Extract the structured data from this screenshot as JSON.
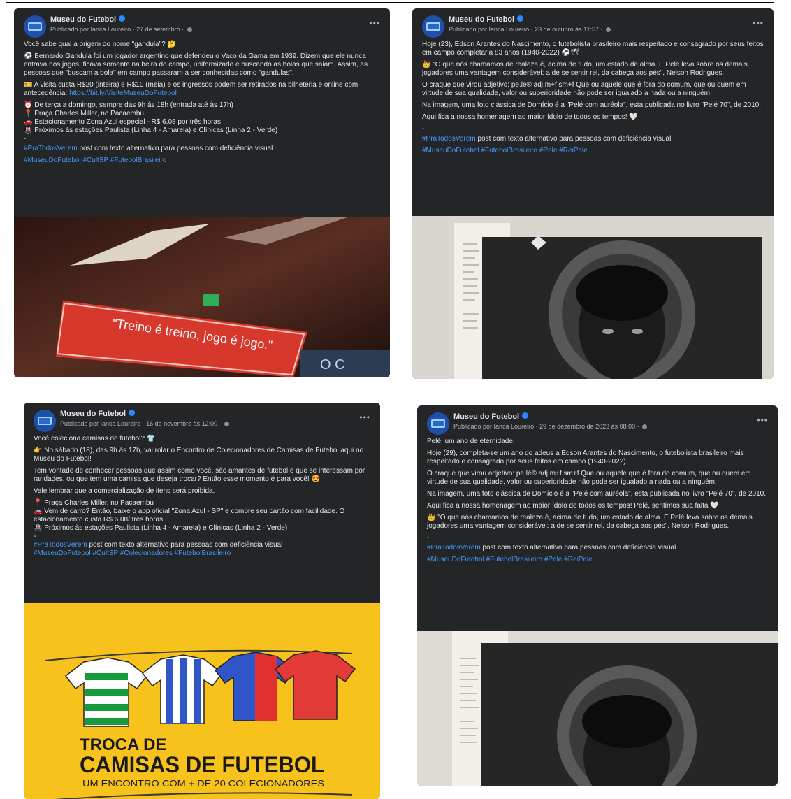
{
  "colors": {
    "post_bg": "#242526",
    "text": "#e4e6eb",
    "meta": "#b0b3b8",
    "hashtag": "#4599ff",
    "verified": "#2d88ff"
  },
  "posts": [
    {
      "page_name": "Museu do Futebol",
      "meta": "Publicado por Ianca Loureiro · 27 de setembro ·",
      "paragraphs": [
        "Você sabe qual a origem do nome \"gandula\"? 🤔",
        "⚽ Bernardo Gandula foi um jogador argentino que defendeu o Vaco da Gama em 1939. Dizem que ele nunca entrava nos jogos, ficava somente na beira do campo, uniformizado e buscando as bolas que saiam. Assim, as pessoas que \"buscam a bola\" em campo passaram a ser conhecidas como \"gandulas\".",
        "🎫 A visita custa R$20 (inteira) e R$10 (meia) e os ingressos podem ser retirados na bilheteria e online com antecedência: ",
        "⏰ De terça a domingo, sempre das 9h às 18h (entrada até às 17h)",
        "📍 Praça Charles Miller, no Pacaembu",
        "🚗 Estacionamento Zona Azul especial - R$ 6,08 por três horas",
        "🚇 Próximos às estações Paulista (Linha 4 - Amarela) e Clínicas (Linha 2 - Verde)"
      ],
      "link": "https://bit.ly/VisiteMuseuDoFutebol",
      "dash": "-",
      "pratodos": "#PraTodosVerem",
      "pratodos_text": " post com texto alternativo para pessoas com deficiência visual",
      "hashtags": "#MuseuDoFutebol #CultSP #FutebolBrasileiro",
      "image_text": "\"Treino é treino, jogo é jogo.\"",
      "image_corner": "O C"
    },
    {
      "page_name": "Museu do Futebol",
      "meta": "Publicado por Ianca Loureiro · 23 de outubro às 11:57 ·",
      "paragraphs": [
        "Hoje (23), Edson Arantes do Nascimento, o futebolista brasileiro mais respeitado e consagrado por seus feitos em campo completaria 83 anos (1940-2022) ⚽🕊",
        "👑 \"O que nós chamamos de realeza é, acima de tudo, um estado de alma. E Pelé leva sobre os demais jogadores uma vantagem considerável: a de se sentir rei, da cabeça aos pés\", Nelson Rodrigues.",
        "O craque que virou adjetivo: pe.lé® adj m+f sm+f Que ou aquele que é fora do comum, que ou quem em virtude de sua qualidade, valor ou superioridade não pode ser igualado a nada ou a ninguém.",
        "Na imagem, uma foto clássica de Domício é a \"Pelé com auréola\", esta publicada no livro \"Pelé 70\", de 2010.",
        "Aqui fica a nossa homenagem ao maior ídolo de todos os tempos! 🤍"
      ],
      "dash": "-",
      "pratodos": "#PraTodosVerem",
      "pratodos_text": " post com texto alternativo para pessoas com deficiência visual",
      "hashtags": "#MuseuDoFutebol #FutebolBrasileiro #Pele #ReiPele"
    },
    {
      "page_name": "Museu do Futebol",
      "meta": "Publicado por Ianca Loureiro · 16 de novembro às 12:00 ·",
      "paragraphs": [
        "Você coleciona camisas de futebol? 👕",
        "👉 No sábado (18), das 9h às 17h, vai rolar o Encontro de Colecionadores de Camisas de Futebol aqui no Museu do Futebol!",
        "Tem vontade de conhecer pessoas que assim como você, são amantes de futebol e que se interessam por raridades, ou que tem uma camisa que deseja trocar? Então esse momento é para você! 😍",
        "Vale lembrar que a comercialização de itens será proibida.",
        "📍 Praça Charles Miller, no Pacaembu",
        "🚗 Vem de carro? Então, baixe o app oficial \"Zona Azul - SP\" e compre seu cartão com facilidade. O estacionamento custa R$ 6,08/ três horas",
        "🚇 Próximos às estações Paulista (Linha 4 - Amarela) e Clínicas (Linha 2 - Verde)"
      ],
      "dash": "-",
      "pratodos": "#PraTodosVerem",
      "pratodos_text": " post com texto alternativo para pessoas com deficiência visual",
      "hashtags": "#MuseuDoFutebol #CultSP #Colecionadores #FutebolBrasileiro",
      "poster_title_1": "TROCA DE",
      "poster_title_2": "CAMISAS DE FUTEBOL",
      "poster_subtitle": "UM ENCONTRO COM + DE 20 COLECIONADORES"
    },
    {
      "page_name": "Museu do Futebol",
      "meta": "Publicado por Ianca Loureiro · 29 de dezembro de 2023 às 08:00 ·",
      "paragraphs": [
        "Pelé, um ano de eternidade.",
        "Hoje (29), completa-se um ano do adeus a Edson Arantes do Nascimento, o futebolista brasileiro mais respeitado e consagrado por seus feitos em campo (1940-2022).",
        "O craque que virou adjetivo: pe.lé® adj m+f sm+f Que ou aquele que é fora do comum, que ou quem em virtude de sua qualidade, valor ou superioridade não pode ser igualado a nada ou a ninguém.",
        "Na imagem, uma foto clássica de Domício é a \"Pelé com auréola\", esta publicada no livro \"Pelé 70\", de 2010.",
        "Aqui fica a nossa homenagem ao maior ídolo de todos os tempos! Pelé, sentimos sua falta 🤍",
        "👑 \"O que nós chamamos de realeza é, acima de tudo, um estado de alma. E Pelé leva sobre os demais jogadores uma vantagem considerável: a de se sentir rei, da cabeça aos pés\", Nelson Rodrigues."
      ],
      "dash": "-",
      "pratodos": "#PraTodosVerem",
      "pratodos_text": " post com texto alternativo para pessoas com deficiência visual",
      "hashtags": "#MuseuDoFutebol #FutebolBrasileiro #Pele #ReiPele"
    }
  ]
}
